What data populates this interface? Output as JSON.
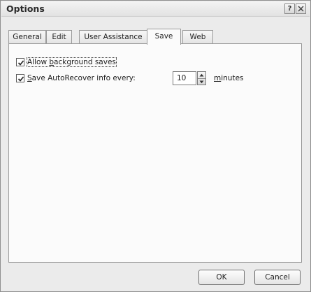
{
  "window": {
    "title": "Options",
    "help_glyph": "?",
    "close_icon": "close-icon"
  },
  "tabs": [
    {
      "label": "General",
      "active": false
    },
    {
      "label": "Edit",
      "active": false
    },
    {
      "label": "User Assistance",
      "active": false
    },
    {
      "label": "Save",
      "active": true
    },
    {
      "label": "Web",
      "active": false
    }
  ],
  "options": {
    "background_saves": {
      "checked": true,
      "label_pre": "Allow ",
      "label_accel": "b",
      "label_post": "ackground saves"
    },
    "autorecover": {
      "checked": true,
      "label_pre": "",
      "label_accel": "S",
      "label_post": "ave AutoRecover info every:",
      "value": "10",
      "unit_pre": "",
      "unit_accel": "m",
      "unit_post": "inutes"
    }
  },
  "buttons": {
    "ok": "OK",
    "cancel": "Cancel"
  },
  "colors": {
    "dialog_bg": "#ebebeb",
    "panel_bg": "#fbfbfb"
  }
}
